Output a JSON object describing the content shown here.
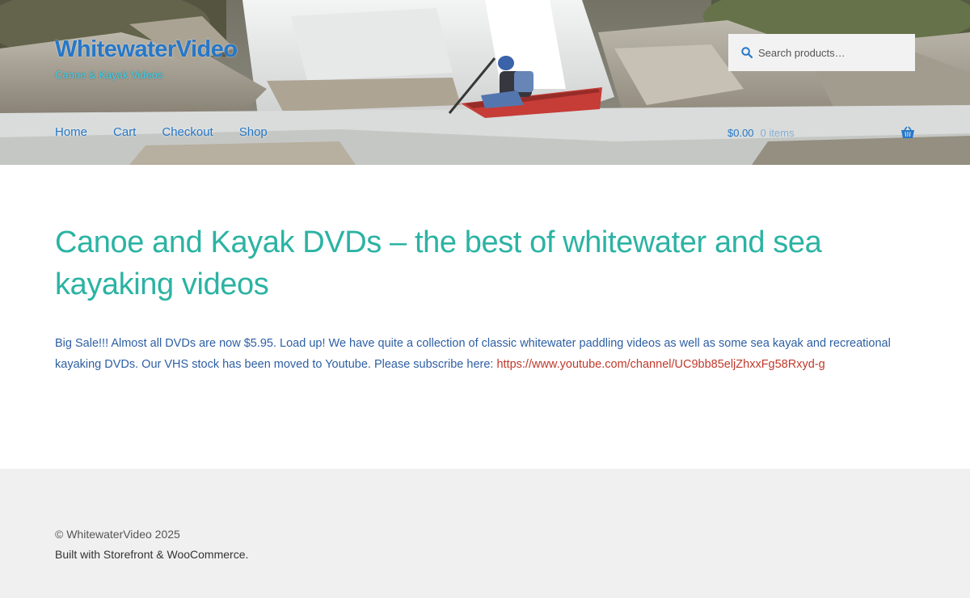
{
  "header": {
    "site_title": "WhitewaterVideo",
    "tagline": "Canoe & Kayak Videos",
    "search": {
      "placeholder": "Search products…",
      "icon": "search-icon"
    },
    "nav": [
      {
        "label": "Home"
      },
      {
        "label": "Cart"
      },
      {
        "label": "Checkout"
      },
      {
        "label": "Shop"
      }
    ],
    "cart": {
      "amount": "$0.00",
      "count": "0 items",
      "icon": "basket-icon"
    }
  },
  "main": {
    "title": "Canoe and Kayak DVDs – the best of whitewater and sea kayaking videos",
    "intro_text": "Big Sale!!! Almost all DVDs are now $5.95.  Load up!  We have quite a collection of classic whitewater paddling videos as well as some sea kayak and recreational kayaking DVDs.  Our VHS stock has been moved to Youtube.  Please subscribe here:  ",
    "youtube_link": "https://www.youtube.com/channel/UC9bb85eljZhxxFg58Rxyd-g"
  },
  "footer": {
    "copyright": "© WhitewaterVideo 2025",
    "credit": "Built with Storefront & WooCommerce."
  },
  "colors": {
    "link_blue": "#2677c8",
    "tagline_cyan": "#3bd1ee",
    "title_teal": "#2bb3a3",
    "body_text": "#2d5fa3",
    "link_red": "#c0392b",
    "footer_bg": "#f0f0f0",
    "search_bg": "#f2f2f2"
  }
}
